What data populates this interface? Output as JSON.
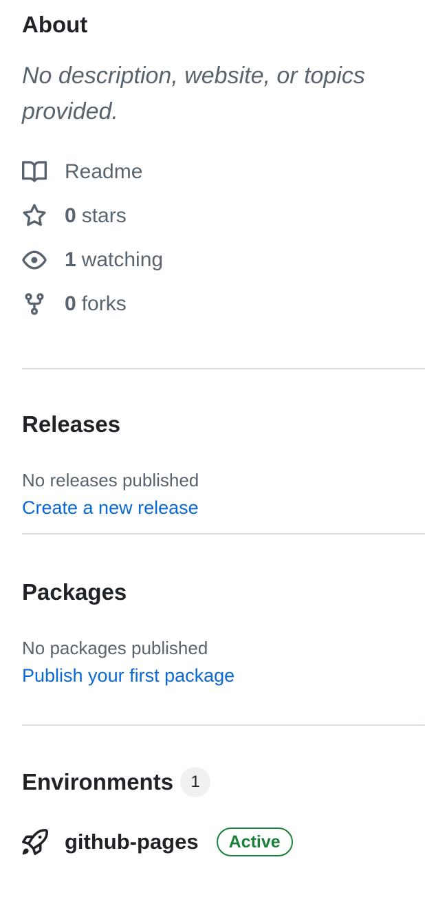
{
  "about": {
    "title": "About",
    "description": "No description, website, or topics provided.",
    "readme_label": "Readme",
    "stars": {
      "count": "0",
      "label": "stars"
    },
    "watching": {
      "count": "1",
      "label": "watching"
    },
    "forks": {
      "count": "0",
      "label": "forks"
    }
  },
  "releases": {
    "title": "Releases",
    "empty_text": "No releases published",
    "link": "Create a new release"
  },
  "packages": {
    "title": "Packages",
    "empty_text": "No packages published",
    "link": "Publish your first package"
  },
  "environments": {
    "title": "Environments",
    "count": "1",
    "items": [
      {
        "name": "github-pages",
        "status": "Active"
      }
    ]
  },
  "colors": {
    "text_primary": "#1f2328",
    "text_muted": "#59636e",
    "link": "#0969da",
    "success": "#1a7f37",
    "divider": "#d8dee4"
  }
}
